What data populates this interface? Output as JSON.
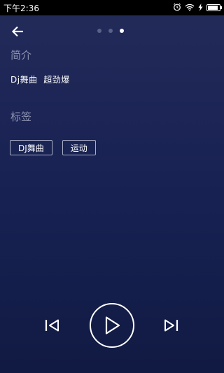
{
  "status_bar": {
    "time": "下午2:36",
    "icons": [
      "alarm-icon",
      "wifi-icon",
      "charging-icon",
      "battery-icon"
    ],
    "battery_level": 0.9
  },
  "header": {
    "back_icon": "arrow-left-icon",
    "pages": 3,
    "active_page": 3
  },
  "intro": {
    "title": "简介",
    "text": "Dj舞曲  超劲爆"
  },
  "tags": {
    "title": "标签",
    "items": [
      "DJ舞曲",
      "运动"
    ]
  },
  "player": {
    "prev_icon": "skip-previous-icon",
    "play_icon": "play-icon",
    "next_icon": "skip-next-icon"
  },
  "colors": {
    "background_top": "#232b58",
    "background_bottom": "#111a42",
    "section_title": "#8d93b0"
  }
}
